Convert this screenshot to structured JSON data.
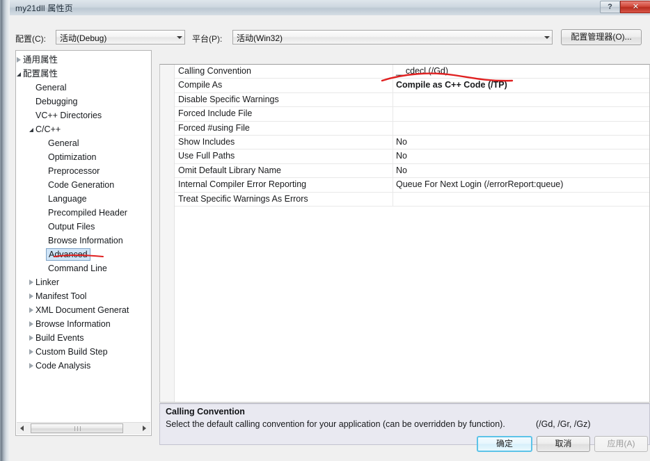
{
  "window": {
    "title": "my21dll 属性页",
    "help_button": "?",
    "close_button": "✕"
  },
  "toolbar": {
    "configuration_label": "配置(C):",
    "configuration_value": "活动(Debug)",
    "platform_label": "平台(P):",
    "platform_value": "活动(Win32)",
    "config_manager_button": "配置管理器(O)..."
  },
  "tree": {
    "nodes": [
      {
        "label": "通用属性",
        "indent": 0,
        "state": "collapsed",
        "selected": false
      },
      {
        "label": "配置属性",
        "indent": 0,
        "state": "expanded",
        "selected": false
      },
      {
        "label": "General",
        "indent": 1,
        "state": "leaf",
        "selected": false
      },
      {
        "label": "Debugging",
        "indent": 1,
        "state": "leaf",
        "selected": false
      },
      {
        "label": "VC++ Directories",
        "indent": 1,
        "state": "leaf",
        "selected": false
      },
      {
        "label": "C/C++",
        "indent": 1,
        "state": "expanded",
        "selected": false
      },
      {
        "label": "General",
        "indent": 2,
        "state": "leaf",
        "selected": false
      },
      {
        "label": "Optimization",
        "indent": 2,
        "state": "leaf",
        "selected": false
      },
      {
        "label": "Preprocessor",
        "indent": 2,
        "state": "leaf",
        "selected": false
      },
      {
        "label": "Code Generation",
        "indent": 2,
        "state": "leaf",
        "selected": false
      },
      {
        "label": "Language",
        "indent": 2,
        "state": "leaf",
        "selected": false
      },
      {
        "label": "Precompiled Header",
        "indent": 2,
        "state": "leaf",
        "selected": false
      },
      {
        "label": "Output Files",
        "indent": 2,
        "state": "leaf",
        "selected": false
      },
      {
        "label": "Browse Information",
        "indent": 2,
        "state": "leaf",
        "selected": false
      },
      {
        "label": "Advanced",
        "indent": 2,
        "state": "leaf",
        "selected": true
      },
      {
        "label": "Command Line",
        "indent": 2,
        "state": "leaf",
        "selected": false
      },
      {
        "label": "Linker",
        "indent": 1,
        "state": "collapsed",
        "selected": false
      },
      {
        "label": "Manifest Tool",
        "indent": 1,
        "state": "collapsed",
        "selected": false
      },
      {
        "label": "XML Document Generat",
        "indent": 1,
        "state": "collapsed",
        "selected": false
      },
      {
        "label": "Browse Information",
        "indent": 1,
        "state": "collapsed",
        "selected": false
      },
      {
        "label": "Build Events",
        "indent": 1,
        "state": "collapsed",
        "selected": false
      },
      {
        "label": "Custom Build Step",
        "indent": 1,
        "state": "collapsed",
        "selected": false
      },
      {
        "label": "Code Analysis",
        "indent": 1,
        "state": "collapsed",
        "selected": false
      }
    ]
  },
  "grid": {
    "rows": [
      {
        "name": "Calling Convention",
        "value": "__cdecl (/Gd)",
        "bold": false
      },
      {
        "name": "Compile As",
        "value": "Compile as C++ Code (/TP)",
        "bold": true
      },
      {
        "name": "Disable Specific Warnings",
        "value": "",
        "bold": false
      },
      {
        "name": "Forced Include File",
        "value": "",
        "bold": false
      },
      {
        "name": "Forced #using File",
        "value": "",
        "bold": false
      },
      {
        "name": "Show Includes",
        "value": "No",
        "bold": false
      },
      {
        "name": "Use Full Paths",
        "value": "No",
        "bold": false
      },
      {
        "name": "Omit Default Library Name",
        "value": "No",
        "bold": false
      },
      {
        "name": "Internal Compiler Error Reporting",
        "value": "Queue For Next Login (/errorReport:queue)",
        "bold": false
      },
      {
        "name": "Treat Specific Warnings As Errors",
        "value": "",
        "bold": false
      }
    ]
  },
  "description": {
    "title": "Calling Convention",
    "text": "Select the default calling convention for your application (can be overridden by function).",
    "switches": "(/Gd, /Gr, /Gz)"
  },
  "footer": {
    "ok_label": "确定",
    "cancel_label": "取消",
    "apply_label": "应用(A)"
  },
  "annotations": {
    "accent_color": "#e02020",
    "marks": [
      {
        "name": "underline-compile-as-value"
      },
      {
        "name": "underline-advanced-tree-item"
      }
    ]
  }
}
